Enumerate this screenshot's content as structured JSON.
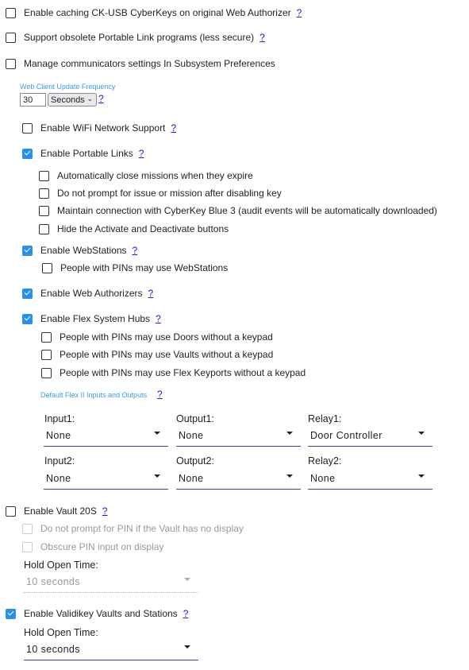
{
  "top_options": [
    {
      "label": "Enable caching CK-USB CyberKeys on original Web Authorizer",
      "checked": false,
      "help": "?"
    },
    {
      "label": "Support obsolete Portable Link programs (less secure)",
      "checked": false,
      "help": "?"
    },
    {
      "label": "Manage communicators settings In Subsystem Preferences",
      "checked": false
    }
  ],
  "web_client": {
    "label": "Web Client Update Frequency",
    "value": "30",
    "unit": "Seconds",
    "help": "?"
  },
  "wifi": {
    "label": "Enable WiFi Network Support",
    "checked": false,
    "help": "?"
  },
  "portable_links": {
    "label": "Enable Portable Links",
    "checked": true,
    "help": "?",
    "options": [
      "Automatically close missions when they expire",
      "Do not prompt for issue or mission after disabling key",
      "Maintain connection with CyberKey Blue 3 (audit events will be automatically downloaded)",
      "Hide the Activate and Deactivate buttons"
    ]
  },
  "webstations": {
    "label": "Enable WebStations",
    "checked": true,
    "help": "?",
    "options": [
      "People with PINs may use WebStations"
    ]
  },
  "web_authorizers": {
    "label": "Enable Web Authorizers",
    "checked": true,
    "help": "?"
  },
  "flex_hubs": {
    "label": "Enable Flex System Hubs",
    "checked": true,
    "help": "?",
    "options": [
      "People with PINs may use Doors without a keypad",
      "People with PINs may use Vaults without a keypad",
      "People with PINs may use Flex Keyports without a keypad"
    ]
  },
  "flex_io": {
    "label": "Default Flex II Inputs and Outputs",
    "help": "?",
    "fields": [
      {
        "label": "Input1:",
        "value": "None"
      },
      {
        "label": "Output1:",
        "value": "None"
      },
      {
        "label": "Relay1:",
        "value": "Door Controller"
      },
      {
        "label": "Input2:",
        "value": "None"
      },
      {
        "label": "Output2:",
        "value": "None"
      },
      {
        "label": "Relay2:",
        "value": "None"
      }
    ]
  },
  "vault20s": {
    "label": "Enable Vault 20S",
    "checked": false,
    "help": "?",
    "options": [
      "Do not prompt for PIN if the Vault has no display",
      "Obscure PIN input on display"
    ],
    "hold_label": "Hold Open Time:",
    "hold_value": "10 seconds"
  },
  "validikey": {
    "label": "Enable Validikey Vaults and Stations",
    "checked": true,
    "help": "?",
    "hold_label": "Hold Open Time:",
    "hold_value": "10 seconds"
  },
  "colors": {
    "accent": "#2b8fe6",
    "link": "#1a1adb",
    "small_label": "#3d9ae8"
  }
}
